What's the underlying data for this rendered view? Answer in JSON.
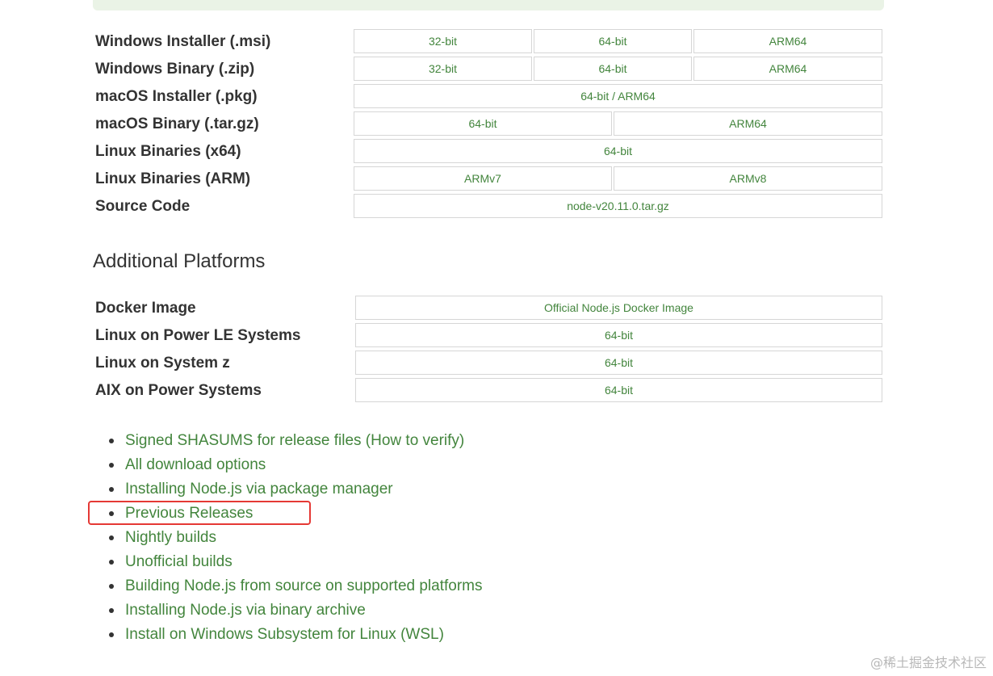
{
  "downloads": [
    {
      "label": "Windows Installer (.msi)",
      "links": [
        "32-bit",
        "64-bit",
        "ARM64"
      ]
    },
    {
      "label": "Windows Binary (.zip)",
      "links": [
        "32-bit",
        "64-bit",
        "ARM64"
      ]
    },
    {
      "label": "macOS Installer (.pkg)",
      "links": [
        "64-bit / ARM64"
      ]
    },
    {
      "label": "macOS Binary (.tar.gz)",
      "links": [
        "64-bit",
        "ARM64"
      ]
    },
    {
      "label": "Linux Binaries (x64)",
      "links": [
        "64-bit"
      ]
    },
    {
      "label": "Linux Binaries (ARM)",
      "links": [
        "ARMv7",
        "ARMv8"
      ]
    },
    {
      "label": "Source Code",
      "links": [
        "node-v20.11.0.tar.gz"
      ]
    }
  ],
  "additional": {
    "heading": "Additional Platforms",
    "rows": [
      {
        "label": "Docker Image",
        "links": [
          "Official Node.js Docker Image"
        ]
      },
      {
        "label": "Linux on Power LE Systems",
        "links": [
          "64-bit"
        ]
      },
      {
        "label": "Linux on System z",
        "links": [
          "64-bit"
        ]
      },
      {
        "label": "AIX on Power Systems",
        "links": [
          "64-bit"
        ]
      }
    ]
  },
  "links": [
    "Signed SHASUMS for release files (How to verify)",
    "All download options",
    "Installing Node.js via package manager",
    "Previous Releases",
    "Nightly builds",
    "Unofficial builds",
    "Building Node.js from source on supported platforms",
    "Installing Node.js via binary archive",
    "Install on Windows Subsystem for Linux (WSL)"
  ],
  "watermark": "@稀土掘金技术社区",
  "colors": {
    "link": "#43853d",
    "highlight": "#e53935"
  }
}
